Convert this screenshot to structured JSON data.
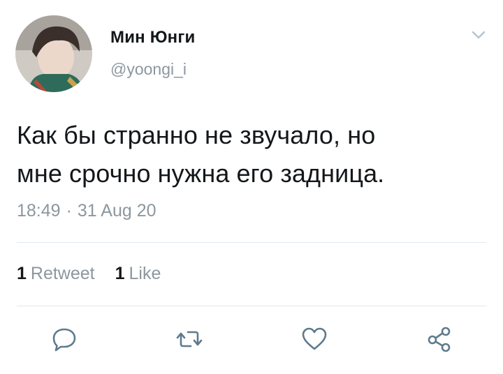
{
  "tweet": {
    "author_name": "Мин Юнги",
    "author_handle": "@yoongi_i",
    "text_line1": "Как бы странно не звучало, но",
    "text_line2": "мне срочно нужна его задница.",
    "time": "18:49",
    "date": "31 Aug 20",
    "separator": "·"
  },
  "stats": {
    "retweets_count": "1",
    "retweets_label": "Retweet",
    "likes_count": "1",
    "likes_label": "Like"
  },
  "icons": {
    "chevron": "chevron-down-icon",
    "reply": "reply-icon",
    "retweet": "retweet-icon",
    "like": "heart-icon",
    "share": "share-icon"
  },
  "colors": {
    "text": "#14171a",
    "secondary": "#8c979f",
    "icon": "#5f7a8d",
    "divider": "#e1e8ed"
  }
}
